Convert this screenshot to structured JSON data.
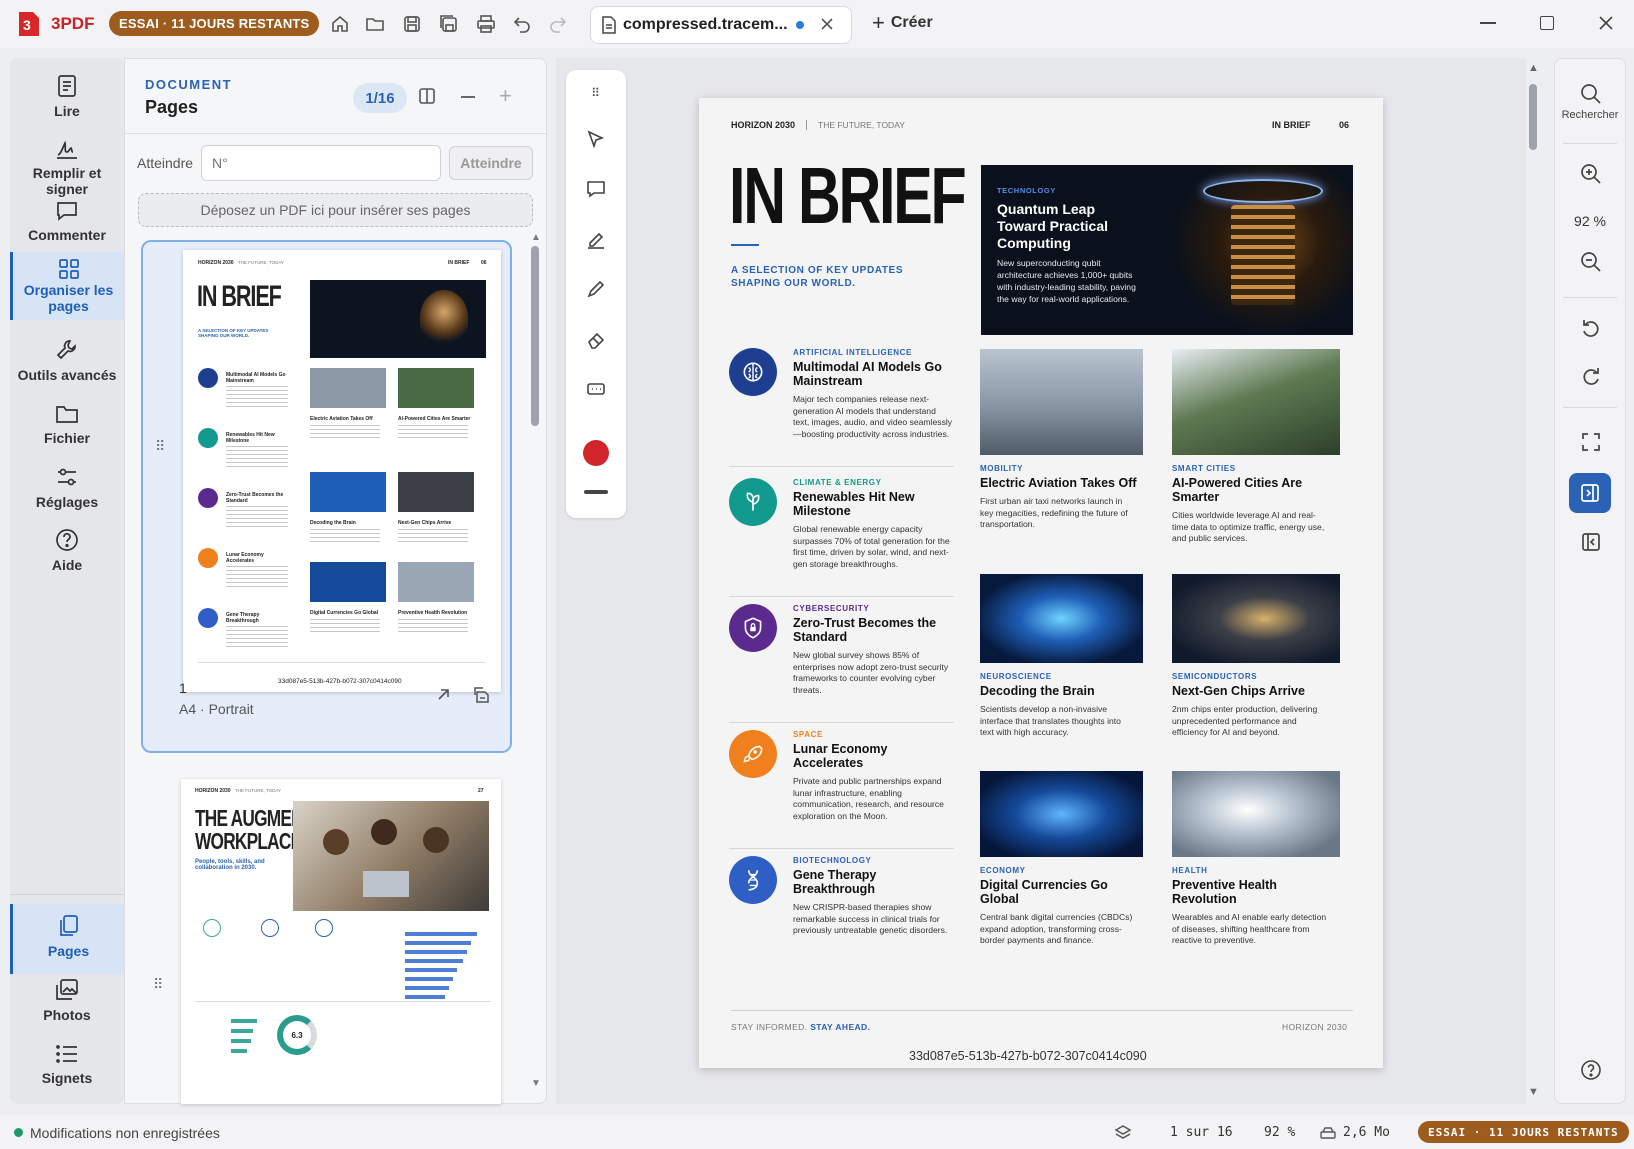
{
  "app": {
    "name": "3PDF",
    "trial_badge": "ESSAI · 11 JOURS RESTANTS"
  },
  "tab": {
    "title": "compressed.tracem...",
    "new_label": "Créer"
  },
  "leftnav": {
    "items": [
      {
        "label": "Lire",
        "icon": "book-icon"
      },
      {
        "label": "Remplir et signer",
        "icon": "signature-icon"
      },
      {
        "label": "Commenter",
        "icon": "comment-icon"
      },
      {
        "label": "Organiser les pages",
        "icon": "grid-icon"
      },
      {
        "label": "Outils avancés",
        "icon": "wrench-icon"
      },
      {
        "label": "Fichier",
        "icon": "folder-icon"
      },
      {
        "label": "Réglages",
        "icon": "sliders-icon"
      },
      {
        "label": "Aide",
        "icon": "help-icon"
      }
    ],
    "bottom": [
      {
        "label": "Pages",
        "icon": "pages-icon"
      },
      {
        "label": "Photos",
        "icon": "photos-icon"
      },
      {
        "label": "Signets",
        "icon": "bookmarks-icon"
      }
    ]
  },
  "panel": {
    "section": "DOCUMENT",
    "title": "Pages",
    "pager": "1/16",
    "goto_label": "Atteindre",
    "goto_placeholder": "N°",
    "goto_button": "Atteindre",
    "dropzone": "Déposez un PDF ici pour insérer ses pages",
    "thumb1_number": "1",
    "thumb1_format": "A4 · Portrait"
  },
  "thumbs": {
    "p1": {
      "header_left": "HORIZON 2030",
      "header_mid": "THE FUTURE, TODAY",
      "header_right": "IN BRIEF",
      "num": "06",
      "title": "IN BRIEF",
      "subtitle": "A SELECTION OF KEY UPDATES SHAPING OUR WORLD.",
      "items": [
        "Multimodal AI Models Go Mainstream",
        "Renewables Hit New Milestone",
        "Zero-Trust Becomes the Standard",
        "Lunar Economy Accelerates",
        "Gene Therapy Breakthrough"
      ],
      "cells": [
        "Electric Aviation Takes Off",
        "AI-Powered Cities Are Smarter",
        "Decoding the Brain",
        "Next-Gen Chips Arrive",
        "Digital Currencies Go Global",
        "Preventive Health Revolution"
      ],
      "footer": "33d087e5-513b-427b-b072-307c0414c090"
    },
    "p2": {
      "header_left": "HORIZON 2030",
      "header_mid": "THE FUTURE, TODAY",
      "num": "27",
      "title_l1": "THE AUGMENTED",
      "title_l2": "WORKPLACE",
      "subtitle": "People, tools, skills, and collaboration in 2030.",
      "donut": "6.3"
    }
  },
  "page": {
    "header_left": "HORIZON 2030",
    "header_mid": "THE FUTURE, TODAY",
    "header_right": "IN BRIEF",
    "page_num": "06",
    "big_title": "IN BRIEF",
    "subtitle": "A SELECTION OF KEY UPDATES SHAPING OUR WORLD.",
    "hero": {
      "category": "TECHNOLOGY",
      "title": "Quantum Leap Toward Practical Computing",
      "body": "New superconducting qubit architecture achieves 1,000+ qubits with industry-leading stability, paving the way for real-world applications."
    },
    "left_items": [
      {
        "category": "ARTIFICIAL INTELLIGENCE",
        "title": "Multimodal AI Models Go Mainstream",
        "body": "Major tech companies release next-generation AI models that understand text, images, audio, and video seamlessly—boosting productivity across industries.",
        "color": "#1e3f8f",
        "icon": "brain-icon"
      },
      {
        "category": "CLIMATE & ENERGY",
        "title": "Renewables Hit New Milestone",
        "body": "Global renewable energy capacity surpasses 70% of total generation for the first time, driven by solar, wind, and next-gen storage breakthroughs.",
        "color": "#139a8e",
        "icon": "leaf-icon"
      },
      {
        "category": "CYBERSECURITY",
        "title": "Zero-Trust Becomes the Standard",
        "body": "New global survey shows 85% of enterprises now adopt zero-trust security frameworks to counter evolving cyber threats.",
        "color": "#5a2a8f",
        "icon": "shield-icon"
      },
      {
        "category": "SPACE",
        "title": "Lunar Economy Accelerates",
        "body": "Private and public partnerships expand lunar infrastructure, enabling communication, research, and resource exploration on the Moon.",
        "color": "#f07f1d",
        "icon": "rocket-icon"
      },
      {
        "category": "BIOTECHNOLOGY",
        "title": "Gene Therapy Breakthrough",
        "body": "New CRISPR-based therapies show remarkable success in clinical trials for previously untreatable genetic disorders.",
        "color": "#2f5fc4",
        "icon": "dna-icon"
      }
    ],
    "grid_items": [
      {
        "category": "MOBILITY",
        "title": "Electric Aviation Takes Off",
        "body": "First urban air taxi networks launch in key megacities, redefining the future of transportation."
      },
      {
        "category": "SMART CITIES",
        "title": "AI-Powered Cities Are Smarter",
        "body": "Cities worldwide leverage AI and real-time data to optimize traffic, energy use, and public services."
      },
      {
        "category": "NEUROSCIENCE",
        "title": "Decoding the Brain",
        "body": "Scientists develop a non-invasive interface that translates thoughts into text with high accuracy."
      },
      {
        "category": "SEMICONDUCTORS",
        "title": "Next-Gen Chips Arrive",
        "body": "2nm chips enter production, delivering unprecedented performance and efficiency for AI and beyond."
      },
      {
        "category": "ECONOMY",
        "title": "Digital Currencies Go Global",
        "body": "Central bank digital currencies (CBDCs) expand adoption, transforming cross-border payments and finance."
      },
      {
        "category": "HEALTH",
        "title": "Preventive Health Revolution",
        "body": "Wearables and AI enable early detection of diseases, shifting healthcare from reactive to preventive."
      }
    ],
    "footer_left": "STAY INFORMED.",
    "footer_accent": "STAY AHEAD.",
    "footer_right": "HORIZON 2030",
    "doc_id": "33d087e5-513b-427b-b072-307c0414c090"
  },
  "rightbar": {
    "search_label": "Rechercher",
    "zoom": "92 %"
  },
  "status": {
    "unsaved": "Modifications non enregistrées",
    "page": "1 sur 16",
    "zoom": "92 %",
    "size": "2,6 Mo",
    "trial": "ESSAI · 11 JOURS RESTANTS"
  },
  "colors": {
    "accent": "#2a62b5",
    "brand": "#d8262a",
    "trial": "#9e5b1e",
    "ink_red": "#d0262b"
  }
}
